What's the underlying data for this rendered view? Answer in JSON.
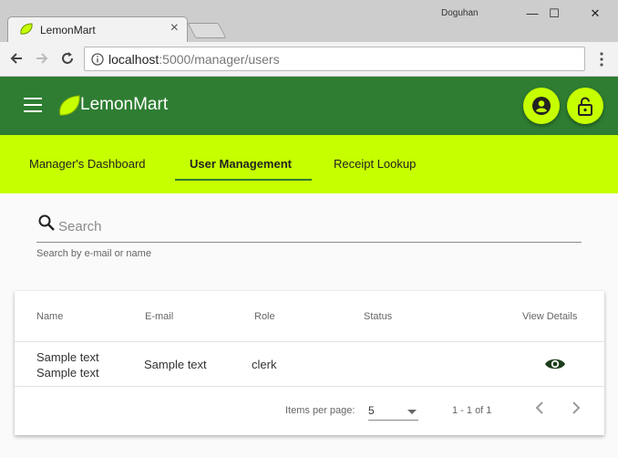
{
  "browser": {
    "tab_title": "LemonMart",
    "tab_close": "×",
    "profile_name": "Doguhan",
    "url_host": "localhost",
    "url_path": ":5000/manager/users",
    "window_controls": {
      "minimize": "—",
      "maximize": "☐",
      "close": "✕"
    }
  },
  "app": {
    "brand": "LemonMart",
    "colors": {
      "primary": "#2e7d32",
      "accent": "#c6ff00"
    }
  },
  "nav": {
    "links": [
      {
        "label": "Manager's Dashboard",
        "active": false
      },
      {
        "label": "User Management",
        "active": true
      },
      {
        "label": "Receipt Lookup",
        "active": false
      }
    ]
  },
  "search": {
    "placeholder": "Search",
    "hint": "Search by e-mail or name"
  },
  "table": {
    "columns": [
      "Name",
      "E-mail",
      "Role",
      "Status",
      "View Details"
    ],
    "rows": [
      {
        "name_line1": "Sample text",
        "name_line2": "Sample text",
        "email": "Sample text",
        "role": "clerk",
        "status": ""
      }
    ]
  },
  "paginator": {
    "items_per_page_label": "Items per page:",
    "page_size": "5",
    "range_label": "1 - 1 of 1"
  }
}
